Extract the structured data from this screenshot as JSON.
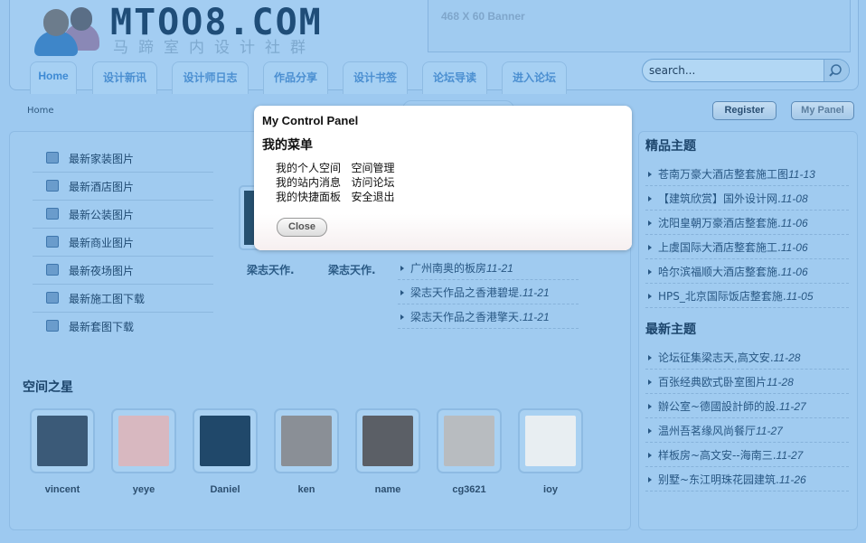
{
  "logo": {
    "text": "MTOO8.COM",
    "subtitle": "马蹄室内设计社群"
  },
  "banner": "468 X 60 Banner",
  "tabs": [
    "Home",
    "设计新讯",
    "设计师日志",
    "作品分享",
    "设计书签",
    "论坛导读",
    "进入论坛"
  ],
  "search": {
    "placeholder": "search..."
  },
  "breadcrumb": "Home",
  "top_buttons": {
    "register": "Register",
    "my_panel": "My Panel"
  },
  "left_menu": [
    "最新家装图片",
    "最新酒店图片",
    "最新公装图片",
    "最新商业图片",
    "最新夜场图片",
    "最新施工图下载",
    "最新套图下载"
  ],
  "thumb_captions": [
    "梁志天作.",
    "梁志天作."
  ],
  "center_list": [
    {
      "title": "广州南奥的板房",
      "date": "11-21"
    },
    {
      "title": "梁志天作品之香港碧堤.",
      "date": "11-21"
    },
    {
      "title": "梁志天作品之香港擎天.",
      "date": "11-21"
    }
  ],
  "stars": {
    "title": "空间之星",
    "users": [
      "vincent",
      "yeye",
      "Daniel",
      "ken",
      "name",
      "cg3621",
      "ioy"
    ]
  },
  "featured": {
    "title": "精品主题",
    "items": [
      {
        "title": "苍南万豪大酒店整套施工图",
        "date": "11-13"
      },
      {
        "title": "【建筑欣赏】国外设计网.",
        "date": "11-08"
      },
      {
        "title": "沈阳皇朝万豪酒店整套施.",
        "date": "11-06"
      },
      {
        "title": "上虞国际大酒店整套施工.",
        "date": "11-06"
      },
      {
        "title": "哈尔滨福顺大酒店整套施.",
        "date": "11-06"
      },
      {
        "title": "HPS_北京国际饭店整套施.",
        "date": "11-05"
      }
    ]
  },
  "latest": {
    "title": "最新主题",
    "items": [
      {
        "title": "论坛征集梁志天,高文安.",
        "date": "11-28"
      },
      {
        "title": "百张经典欧式卧室图片",
        "date": "11-28"
      },
      {
        "title": "辦公室~德國設計師的設.",
        "date": "11-27"
      },
      {
        "title": "温州吾茗缘风尚餐厅",
        "date": "11-27"
      },
      {
        "title": "样板房~高文安--海南三.",
        "date": "11-27"
      },
      {
        "title": "别墅~东江明珠花园建筑.",
        "date": "11-26"
      }
    ]
  },
  "modal": {
    "title": "My Control Panel",
    "subtitle": "我的菜单",
    "links": [
      [
        "我的个人空间",
        "空间管理"
      ],
      [
        "我的站内消息",
        "访问论坛"
      ],
      [
        "我的快捷面板",
        "安全退出"
      ]
    ],
    "close": "Close"
  }
}
